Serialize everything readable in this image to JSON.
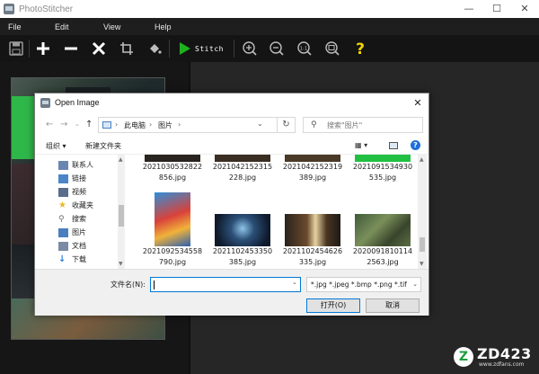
{
  "app": {
    "title": "PhotoStitcher",
    "window_controls": {
      "minimize": "—",
      "maximize": "☐",
      "close": "✕"
    }
  },
  "menu": [
    "File",
    "Edit",
    "View",
    "Help"
  ],
  "toolbar": {
    "stitch_label": "Stitch",
    "icons": [
      "save-icon",
      "add-icon",
      "remove-icon",
      "clear-icon",
      "crop-icon",
      "fill-icon",
      "stitch-icon",
      "zoom-in-icon",
      "zoom-out-icon",
      "actual-size-icon",
      "fit-icon",
      "help-icon"
    ],
    "colors": {
      "stitch": "#1db21d",
      "help": "#f2d400"
    }
  },
  "dialog": {
    "title": "Open Image",
    "close": "✕",
    "nav": {
      "back": "←",
      "forward": "→",
      "up": "↑",
      "dropdown": "⌄"
    },
    "breadcrumb": [
      "此电脑",
      "图片"
    ],
    "breadcrumb_sep": "›",
    "refresh": "↻",
    "search_placeholder": "搜索\"图片\"",
    "organize": "组织 ▾",
    "new_folder": "新建文件夹",
    "view_label": "▦ ▾",
    "nav_items": [
      {
        "label": "联系人",
        "icon": "contacts-icon",
        "color": "#6a86b0"
      },
      {
        "label": "链接",
        "icon": "link-icon",
        "color": "#4a86c8"
      },
      {
        "label": "视频",
        "icon": "video-icon",
        "color": "#5a6d8a"
      },
      {
        "label": "收藏夹",
        "icon": "star-icon",
        "color": "#e5b92a"
      },
      {
        "label": "搜索",
        "icon": "search-icon",
        "color": "#6e6e6e"
      },
      {
        "label": "图片",
        "icon": "pictures-icon",
        "color": "#4a7fbf"
      },
      {
        "label": "文档",
        "icon": "documents-icon",
        "color": "#7a8aa5"
      },
      {
        "label": "下载",
        "icon": "download-icon",
        "color": "#2f7fd6"
      }
    ],
    "files_row1": [
      {
        "name": "2021030532822\n856.jpg"
      },
      {
        "name": "2021042152315\n228.jpg"
      },
      {
        "name": "2021042152319\n389.jpg"
      },
      {
        "name": "2021091534930\n535.jpg"
      }
    ],
    "files_row2": [
      {
        "name": "2021092534558\n790.jpg"
      },
      {
        "name": "2021102453350\n385.jpg"
      },
      {
        "name": "2021102454626\n335.jpg"
      },
      {
        "name": "2020091810114\n2563.jpg"
      }
    ],
    "filename_label": "文件名(N):",
    "filename_value": "",
    "filetype": "*.jpg *.jpeg *.bmp *.png *.tif",
    "open_button": "打开(O)",
    "cancel_button": "取消"
  },
  "watermark": {
    "badge": "Z",
    "text": "ZD423",
    "sub": "www.zdfans.com"
  }
}
